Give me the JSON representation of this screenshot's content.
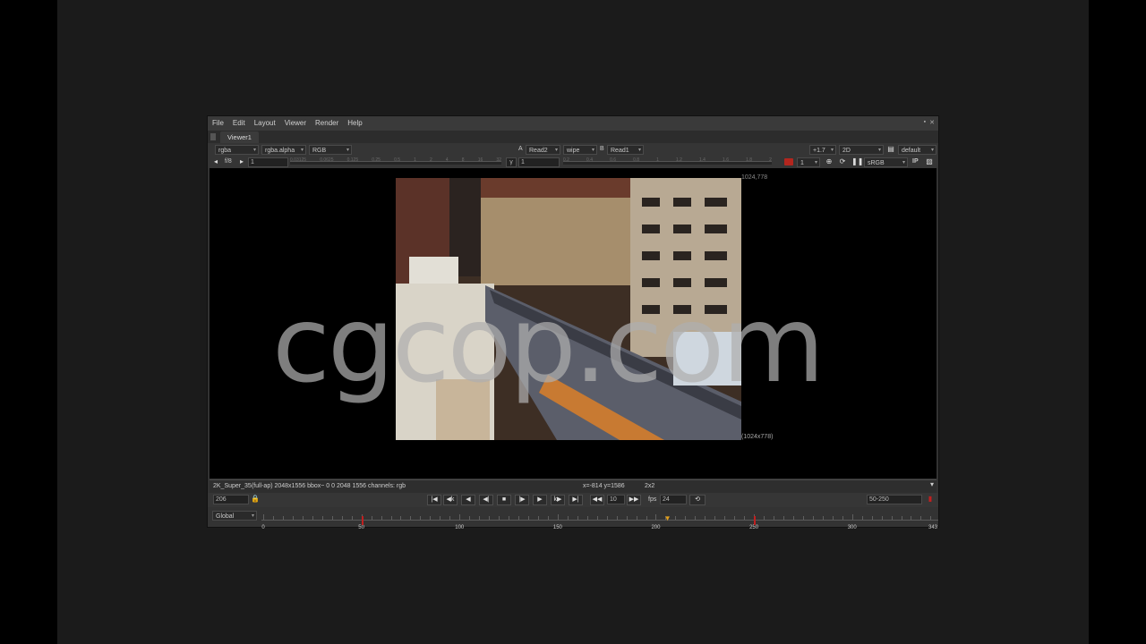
{
  "menu": [
    "File",
    "Edit",
    "Layout",
    "Viewer",
    "Render",
    "Help"
  ],
  "tab": {
    "label": "Viewer1"
  },
  "toolbar1": {
    "channels": "rgba",
    "alpha": "rgba.alpha",
    "display": "RGB",
    "a_label": "A",
    "a_input": "Read2",
    "wipe": "wipe",
    "b_label": "B",
    "b_input": "Read1",
    "gain": "+1.7",
    "view_mode": "2D",
    "lut_default": "default"
  },
  "toolbar2": {
    "fstop": "f/8",
    "gain_value": "1",
    "gamma_label": "γ",
    "gamma_value": "1",
    "proxy": "1",
    "colorspace": "sRGB",
    "ip": "IP"
  },
  "viewer": {
    "format_tr": "1024,778",
    "format_br": "(1024x778)",
    "watermark": "cgcop.com"
  },
  "info": {
    "format": "2K_Super_35(full-ap) 2048x1556 bbox~ 0 0 2048 1556 channels: rgb",
    "coords": "x=-814 y=1586",
    "zoom": "2x2"
  },
  "transport": {
    "frame": "206",
    "increment": "10",
    "fps_label": "fps",
    "fps": "24",
    "range": "50-250"
  },
  "timeline": {
    "scope": "Global",
    "start": 0,
    "end": 343,
    "current_frame": 206,
    "tick_labels": [
      "0",
      "50",
      "100",
      "150",
      "200",
      "250",
      "300",
      "343"
    ],
    "keyframes": [
      50,
      250
    ]
  }
}
